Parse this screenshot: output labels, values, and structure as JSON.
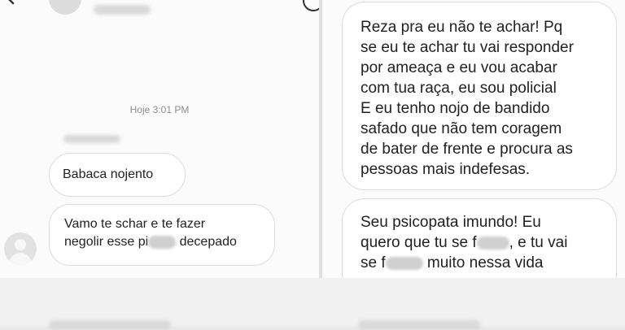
{
  "left_thread": {
    "timestamp": "Hoje 3:01 PM",
    "messages": [
      {
        "text": "Babaca nojento"
      },
      {
        "line1": "Vamo te schar e te fazer",
        "line2_part1": "negolir esse pi",
        "line2_part2": " decepado"
      }
    ]
  },
  "right_thread": {
    "messages": [
      {
        "text": "Reza pra eu não te achar! Pq\nse eu te achar tu vai responder\npor ameaça e eu vou acabar\ncom tua raça, eu sou policial\nE eu tenho nojo de bandido\nsafado que não tem coragem\nde bater de frente e procura as\npessoas mais indefesas."
      },
      {
        "line1": "Seu psicopata imundo! Eu",
        "line2_part1": "quero que tu se f",
        "line2_part2": ", e tu vai",
        "line3_part1": "se f",
        "line3_part2": " muito nessa vida"
      }
    ]
  },
  "icons": {
    "back": "arrow-left-icon",
    "info": "info-icon",
    "avatar": "default-avatar-icon"
  }
}
